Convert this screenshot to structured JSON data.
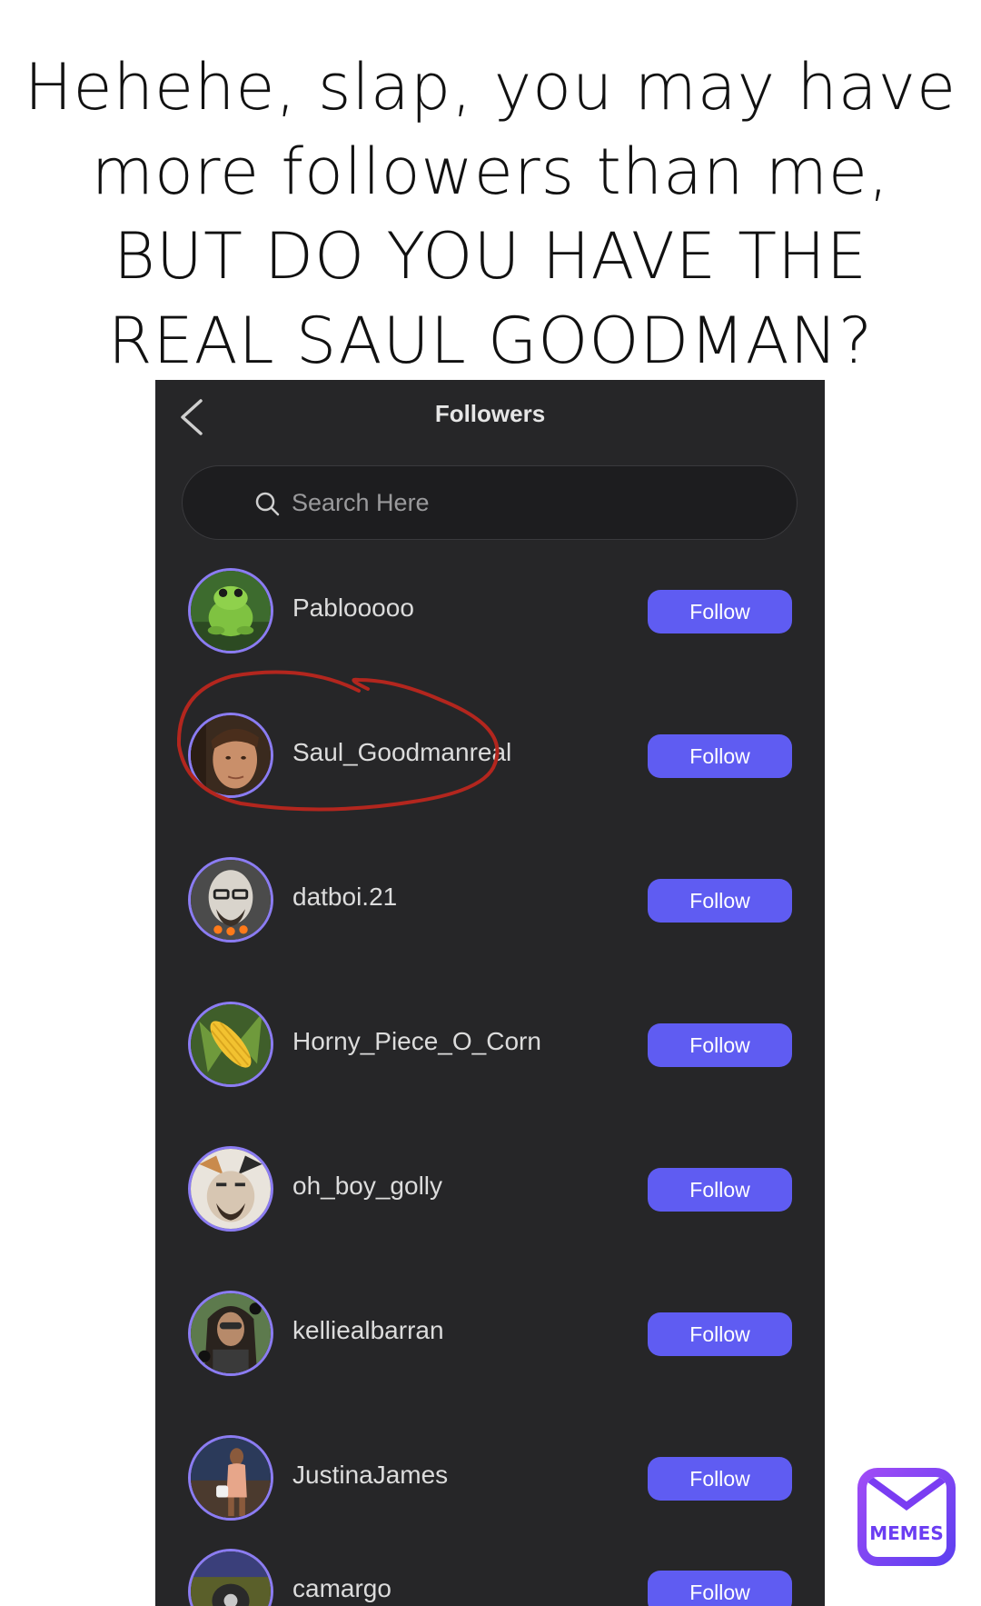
{
  "caption": {
    "line1": "Hehehe, slap, you may have",
    "line2": "more followers than me,",
    "line3": "BUT DO YOU HAVE THE",
    "line4": "REAL SAUL GOODMAN?"
  },
  "header": {
    "title": "Followers",
    "back_icon": "chevron-left-icon"
  },
  "search": {
    "placeholder": "Search Here",
    "icon": "search-icon"
  },
  "followers": [
    {
      "username": "Pablooooo",
      "button": "Follow",
      "avatar_icon": "frog-avatar"
    },
    {
      "username": "Saul_Goodmanreal",
      "button": "Follow",
      "avatar_icon": "man-face-avatar"
    },
    {
      "username": "datboi.21",
      "button": "Follow",
      "avatar_icon": "bald-man-avatar"
    },
    {
      "username": "Horny_Piece_O_Corn",
      "button": "Follow",
      "avatar_icon": "corn-avatar"
    },
    {
      "username": "oh_boy_golly",
      "button": "Follow",
      "avatar_icon": "cat-face-avatar"
    },
    {
      "username": "kelliealbarran",
      "button": "Follow",
      "avatar_icon": "woman-avatar"
    },
    {
      "username": "JustinaJames",
      "button": "Follow",
      "avatar_icon": "woman-avatar"
    },
    {
      "username": "camargo",
      "button": "Follow",
      "avatar_icon": "person-avatar"
    }
  ],
  "colors": {
    "panel_bg": "#262628",
    "accent": "#5f5cf2",
    "avatar_ring": "#8b7cf2",
    "annotation": "#b3261e"
  },
  "watermark": {
    "text": "MEMES"
  }
}
